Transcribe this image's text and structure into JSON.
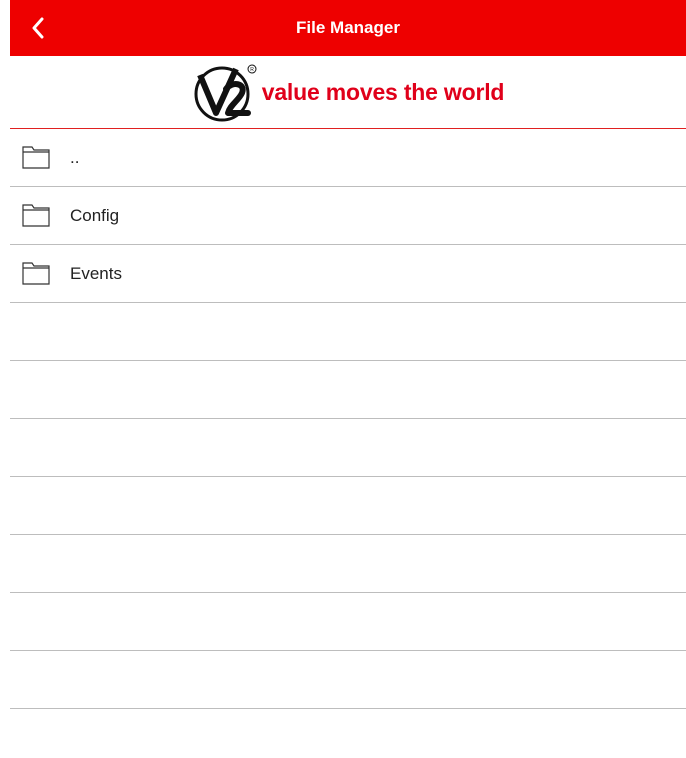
{
  "header": {
    "title": "File Manager",
    "back_icon": "chevron-left-icon",
    "background_color": "#ee0000"
  },
  "brand": {
    "logo_text": "V2",
    "tagline": "value moves the world",
    "accent_color": "#e0001a"
  },
  "files": [
    {
      "name": "..",
      "icon": "folder-icon"
    },
    {
      "name": "Config",
      "icon": "folder-icon"
    },
    {
      "name": "Events",
      "icon": "folder-icon"
    }
  ],
  "empty_rows": 7
}
